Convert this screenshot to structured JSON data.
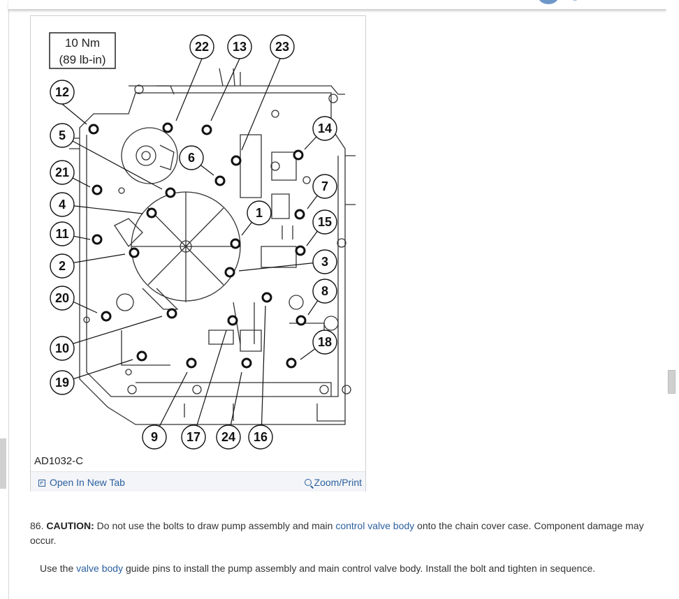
{
  "figure": {
    "torque_line1": "10 Nm",
    "torque_line2": "(89 lb-in)",
    "callouts": [
      {
        "label": "22"
      },
      {
        "label": "13"
      },
      {
        "label": "23"
      },
      {
        "label": "12"
      },
      {
        "label": "5"
      },
      {
        "label": "6"
      },
      {
        "label": "21"
      },
      {
        "label": "4"
      },
      {
        "label": "11"
      },
      {
        "label": "1"
      },
      {
        "label": "2"
      },
      {
        "label": "20"
      },
      {
        "label": "10"
      },
      {
        "label": "19"
      },
      {
        "label": "14"
      },
      {
        "label": "7"
      },
      {
        "label": "15"
      },
      {
        "label": "3"
      },
      {
        "label": "8"
      },
      {
        "label": "18"
      },
      {
        "label": "9"
      },
      {
        "label": "17"
      },
      {
        "label": "24"
      },
      {
        "label": "16"
      }
    ],
    "figure_id": "AD1032-C",
    "open_new_tab": "Open In New Tab",
    "zoom_print": "Zoom/Print"
  },
  "step": {
    "number": "86.",
    "caution_label": "CAUTION:",
    "caution_before": " Do not use the bolts to draw pump assembly and main ",
    "caution_link": "control valve body",
    "caution_after": " onto the chain cover case. Component damage may occur."
  },
  "instruction": {
    "before": "Use the ",
    "link": "valve body",
    "after": " guide pins to install the pump assembly and main control valve body. Install the bolt and tighten in sequence."
  }
}
